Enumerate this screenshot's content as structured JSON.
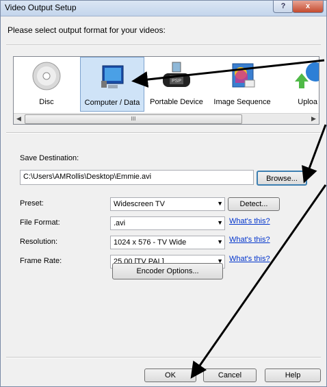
{
  "window": {
    "title": "Video Output Setup",
    "help_label": "?",
    "close_label": "x"
  },
  "prompt": "Please select output format for your videos:",
  "formats": [
    {
      "label": "Disc",
      "icon": "disc-icon"
    },
    {
      "label": "Computer / Data",
      "icon": "computer-icon",
      "selected": true
    },
    {
      "label": "Portable Device",
      "icon": "psp-icon",
      "device_text": "PSP"
    },
    {
      "label": "Image Sequence",
      "icon": "image-sequence-icon"
    },
    {
      "label": "Uploa",
      "icon": "upload-icon"
    }
  ],
  "scrollbar": {
    "left_arrow": "◀",
    "right_arrow": "▶",
    "thumb_grip": "III"
  },
  "save_destination": {
    "label": "Save Destination:",
    "path": "C:\\Users\\AMRollis\\Desktop\\Emmie.avi",
    "browse_label": "Browse..."
  },
  "preset": {
    "label": "Preset:",
    "value": "Widescreen TV",
    "detect_label": "Detect..."
  },
  "file_format": {
    "label": "File Format:",
    "value": ".avi",
    "help_link": "What's this?"
  },
  "resolution": {
    "label": "Resolution:",
    "value": "1024 x 576 - TV Wide",
    "help_link": "What's this?"
  },
  "frame_rate": {
    "label": "Frame Rate:",
    "value": "25.00 [TV PAL]",
    "help_link": "What's this?"
  },
  "encoder_options_label": "Encoder Options...",
  "dialog_buttons": {
    "ok": "OK",
    "cancel": "Cancel",
    "help": "Help"
  },
  "dropdown_arrow": "▼"
}
